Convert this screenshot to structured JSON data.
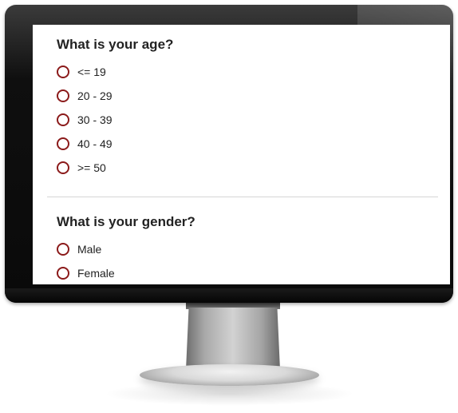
{
  "survey": {
    "age": {
      "title": "What is your age?",
      "options": [
        "<= 19",
        "20 - 29",
        "30 - 39",
        "40 - 49",
        ">= 50"
      ]
    },
    "gender": {
      "title": "What is your gender?",
      "options": [
        "Male",
        "Female"
      ]
    }
  },
  "colors": {
    "radio_border": "#8b1a1a",
    "text": "#222222",
    "bezel": "#0a0a0a"
  }
}
